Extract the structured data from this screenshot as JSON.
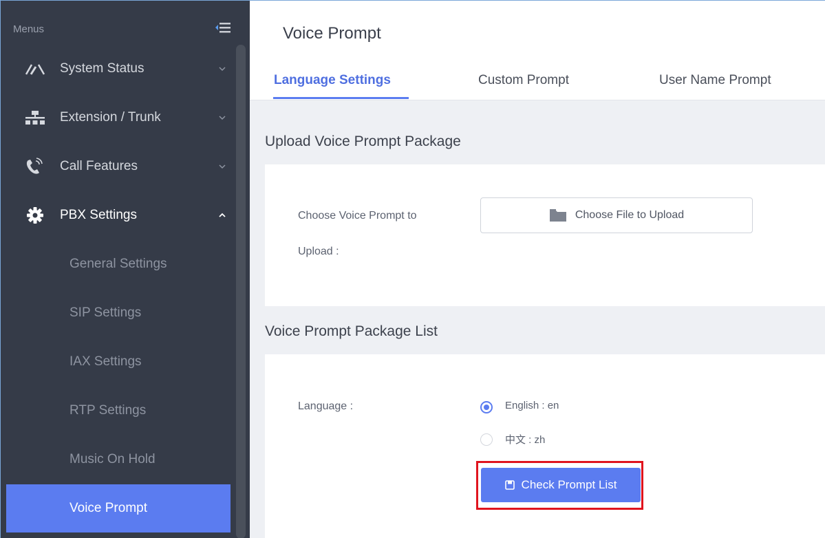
{
  "sidebar": {
    "menus_label": "Menus",
    "items": [
      {
        "label": "System Status",
        "icon": "gauge-icon"
      },
      {
        "label": "Extension / Trunk",
        "icon": "network-icon"
      },
      {
        "label": "Call Features",
        "icon": "phone-icon"
      },
      {
        "label": "PBX Settings",
        "icon": "gear-icon"
      }
    ],
    "subitems": [
      {
        "label": "General Settings"
      },
      {
        "label": "SIP Settings"
      },
      {
        "label": "IAX Settings"
      },
      {
        "label": "RTP Settings"
      },
      {
        "label": "Music On Hold"
      },
      {
        "label": "Voice Prompt"
      }
    ],
    "active_subitem": "Voice Prompt"
  },
  "main": {
    "title": "Voice Prompt",
    "tabs": [
      {
        "label": "Language Settings"
      },
      {
        "label": "Custom Prompt"
      },
      {
        "label": "User Name Prompt"
      }
    ],
    "active_tab": "Language Settings",
    "upload_section": {
      "title": "Upload Voice Prompt Package",
      "field_label_line1": "Choose Voice Prompt to",
      "field_label_line2": "Upload :",
      "button_label": "Choose File to Upload"
    },
    "list_section": {
      "title": "Voice Prompt Package List",
      "language_label": "Language :",
      "options": [
        {
          "label": "English : en",
          "selected": true
        },
        {
          "label": "中文 : zh",
          "selected": false
        }
      ],
      "check_button_label": "Check Prompt List"
    }
  },
  "colors": {
    "sidebar_bg": "#353b48",
    "accent": "#5b7cf0",
    "highlight": "#e0141e"
  }
}
